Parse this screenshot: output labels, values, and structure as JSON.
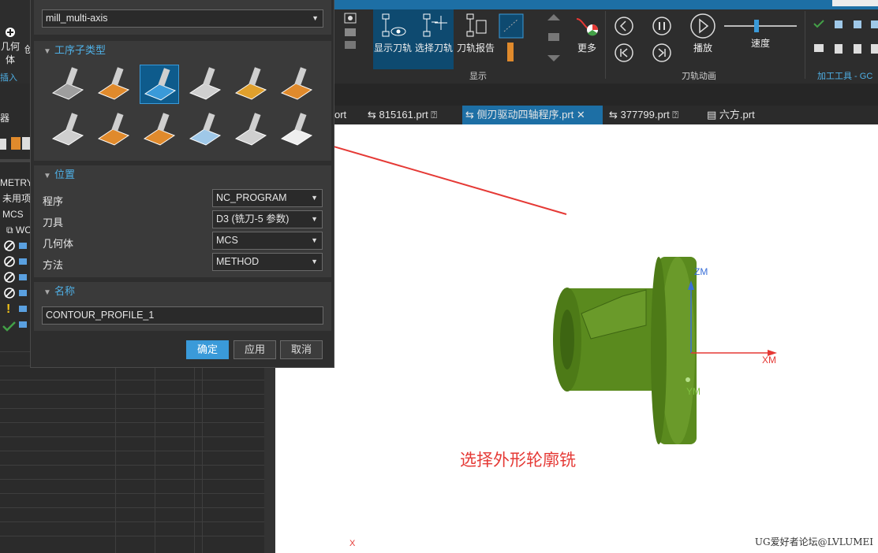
{
  "colors": {
    "accent": "#1d6fa5",
    "dialog_header": "#4fb0e6",
    "part_green": "#5a8a1e",
    "annotation_red": "#e53935"
  },
  "ribbon": {
    "left_partial": {
      "geometry_label": "几何体",
      "insert_label": "插入",
      "partial_label": "创"
    },
    "display_group": {
      "label": "显示",
      "buttons": [
        {
          "label": "显示刀轨",
          "icon": "show-toolpath-icon"
        },
        {
          "label": "选择刀轨",
          "icon": "select-toolpath-icon"
        },
        {
          "label": "刀轨报告",
          "icon": "toolpath-report-icon"
        },
        {
          "label": "更多",
          "icon": "more-icon"
        }
      ]
    },
    "animation_group": {
      "label": "刀轨动画",
      "play_label": "播放",
      "speed_label": "速度"
    },
    "tools_group": {
      "label": "加工工具 - GC工"
    }
  },
  "tabs": [
    {
      "label": "ort",
      "active": false
    },
    {
      "label": "815161.prt",
      "active": false
    },
    {
      "label": "侧刃驱动四轴程序.prt",
      "active": true
    },
    {
      "label": "377799.prt",
      "active": false
    },
    {
      "label": "六方.prt",
      "active": false
    }
  ],
  "navigator": {
    "header": "器",
    "rows": [
      "METRY",
      "未用项",
      "MCS",
      "WC"
    ]
  },
  "dialog": {
    "type_value": "mill_multi-axis",
    "subtype_section": "工序子类型",
    "subtype_icons": [
      "variable-contour-icon",
      "variable-streamline-icon",
      "contour-profile-icon",
      "fixed-contour-icon",
      "tube-rough-icon",
      "tube-finish-icon",
      "generic-motion-icon",
      "turbine-blade-icon",
      "turbine-hub-icon",
      "surface-contour-icon",
      "mill-user-icon",
      "document-icon"
    ],
    "selected_subtype": 2,
    "location_section": "位置",
    "location": [
      {
        "label": "程序",
        "value": "NC_PROGRAM"
      },
      {
        "label": "刀具",
        "value": "D3 (铣刀-5 参数)"
      },
      {
        "label": "几何体",
        "value": "MCS"
      },
      {
        "label": "方法",
        "value": "METHOD"
      }
    ],
    "name_section": "名称",
    "name_value": "CONTOUR_PROFILE_1",
    "ok_label": "确定",
    "apply_label": "应用",
    "cancel_label": "取消"
  },
  "viewport": {
    "axis_zm": "ZM",
    "axis_xm": "XM",
    "axis_ym": "YM",
    "corner_axis": "X",
    "annotation": "选择外形轮廓铣",
    "watermark": "UG爱好者论坛@LVLUMEI"
  }
}
